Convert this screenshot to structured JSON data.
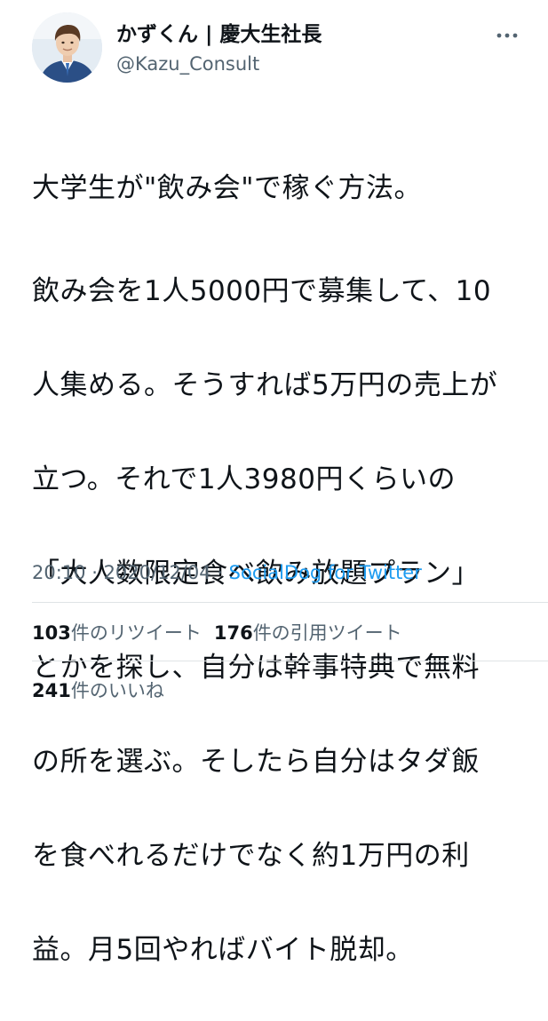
{
  "author": {
    "display_name": "かずくん | 慶大生社長",
    "handle": "@Kazu_Consult",
    "avatar": "profile-photo"
  },
  "header": {
    "more_icon": "more-horizontal-icon"
  },
  "tweet": {
    "first_line": "大学生が\"飲み会\"で稼ぐ方法。",
    "lines": [
      "飲み会を1人5000円で募集して、10",
      "人集める。そうすれば5万円の売上が",
      "立つ。それで1人3980円くらいの",
      "「大人数限定食べ飲み放題プラン」",
      "とかを探し、自分は幹事特典で無料",
      "の所を選ぶ。そしたら自分はタダ飯",
      "を食べれるだけでなく約1万円の利",
      "益。月5回やればバイト脱却。"
    ]
  },
  "meta": {
    "time": "20:10",
    "separator1": " · ",
    "date": "2020/12/04",
    "separator2": " · ",
    "source": "SocialDog for Twitter"
  },
  "stats": {
    "retweets_count": "103",
    "retweets_label": "件のリツイート",
    "quotes_count": "176",
    "quotes_label": "件の引用ツイート",
    "likes_count": "241",
    "likes_label": "件のいいね"
  },
  "colors": {
    "text": "#0f1419",
    "secondary": "#536471",
    "link": "#1d9bf0",
    "divider": "#dfe3e6"
  }
}
